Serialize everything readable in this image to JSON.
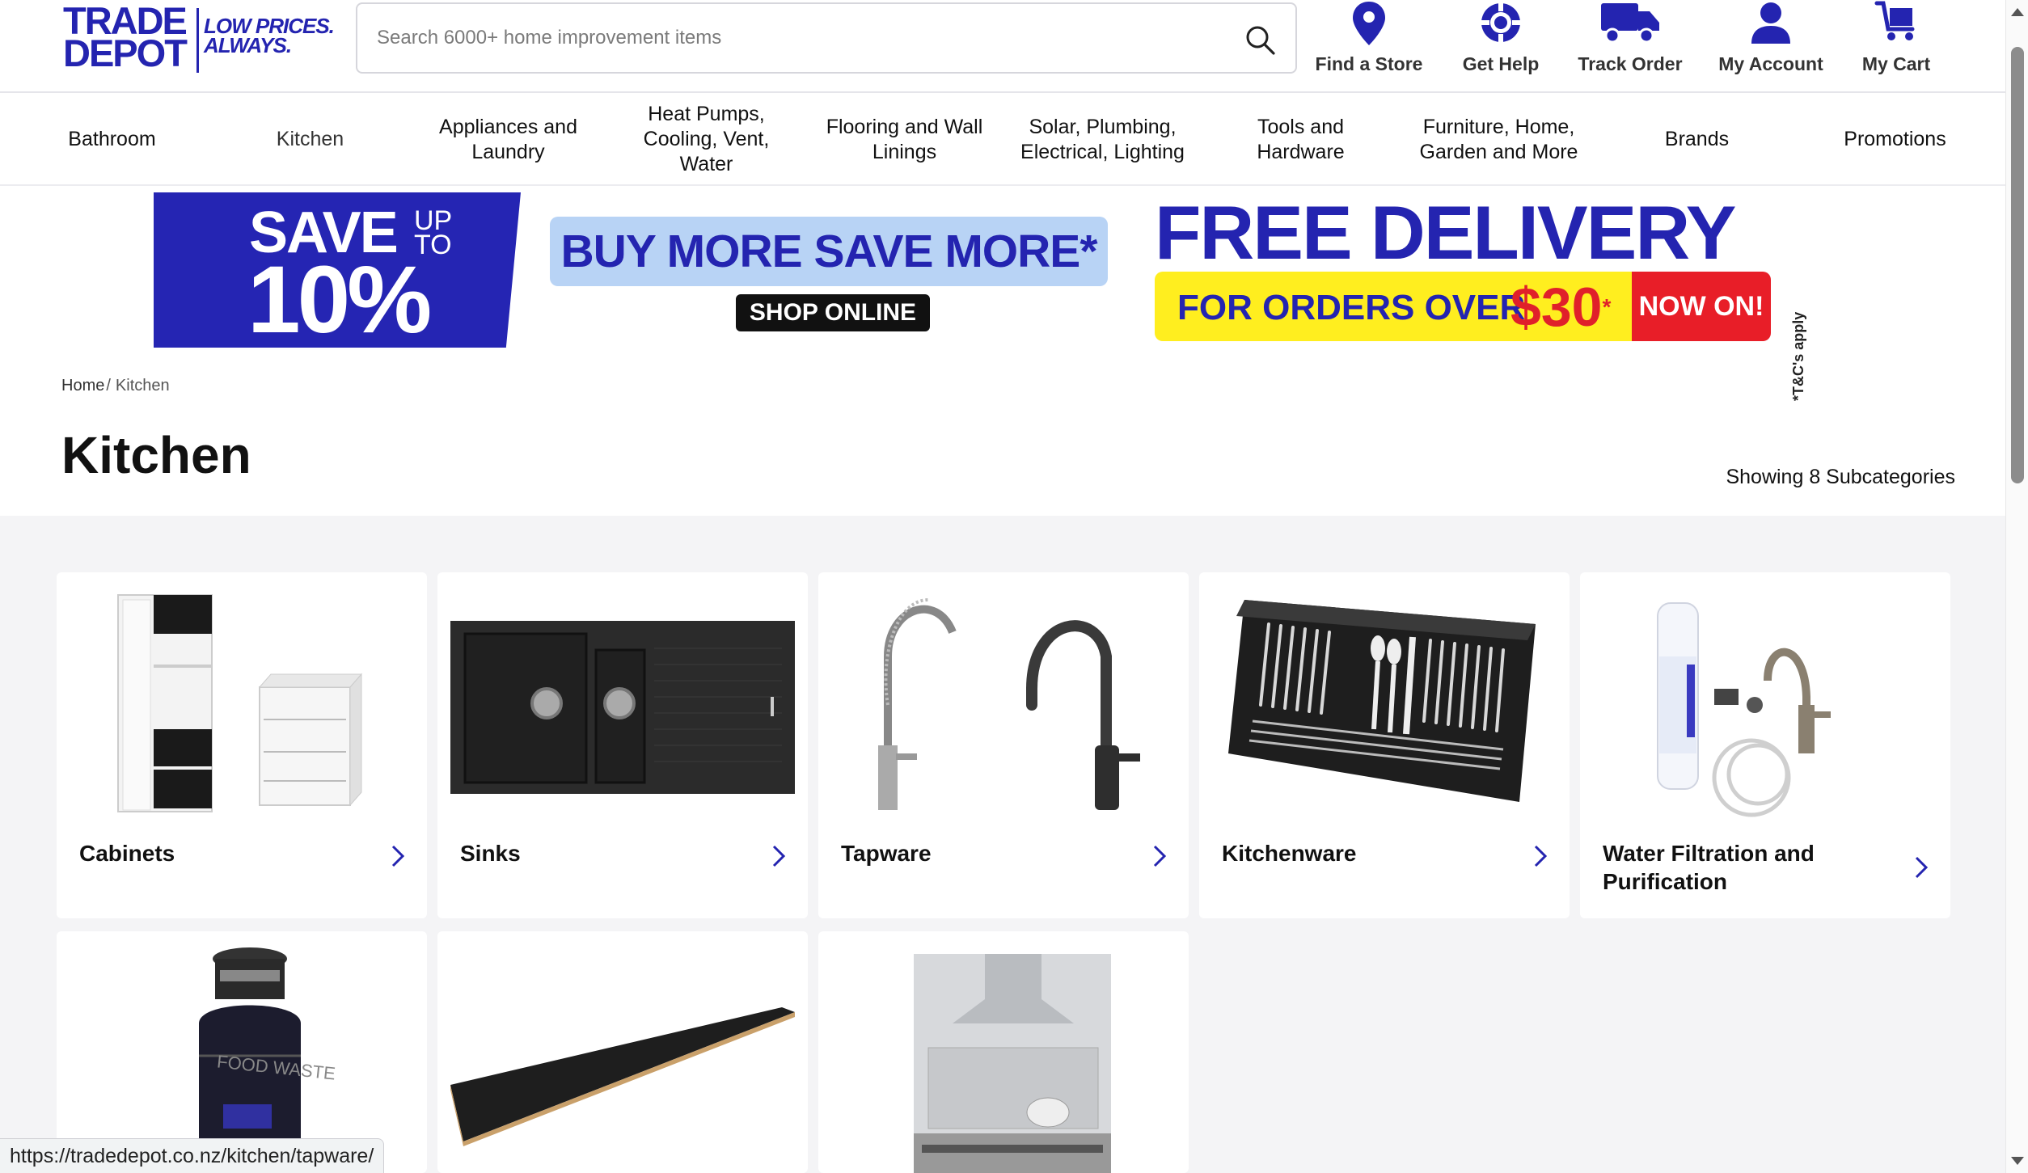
{
  "brand": {
    "logo_line1": "TRADE",
    "logo_line2": "DEPOT",
    "tagline1": "LOW PRICES.",
    "tagline2": "ALWAYS.",
    "color": "#2424b0"
  },
  "search": {
    "placeholder": "Search 6000+ home improvement items",
    "value": ""
  },
  "header_nav": [
    {
      "label": "Find a Store",
      "icon": "map-pin-icon"
    },
    {
      "label": "Get Help",
      "icon": "lifebuoy-icon"
    },
    {
      "label": "Track Order",
      "icon": "truck-icon"
    },
    {
      "label": "My Account",
      "icon": "user-icon"
    },
    {
      "label": "My Cart",
      "icon": "cart-icon"
    }
  ],
  "categories": [
    "Bathroom",
    "Kitchen",
    "Appliances and Laundry",
    "Heat Pumps, Cooling, Vent, Water",
    "Flooring and Wall Linings",
    "Solar, Plumbing, Electrical, Lighting",
    "Tools and Hardware",
    "Furniture, Home, Garden and More",
    "Brands",
    "Promotions"
  ],
  "banner": {
    "save": "SAVE",
    "up_to_1": "UP",
    "up_to_2": "TO",
    "percent": "10%",
    "headline": "BUY MORE SAVE MORE*",
    "cta": "SHOP ONLINE",
    "free_delivery": "FREE DELIVERY",
    "orders_over": "FOR ORDERS OVER",
    "amount": "$30",
    "amount_mark": "*",
    "now_on": "NOW ON!",
    "terms": "*T&C's apply"
  },
  "breadcrumb": {
    "home": "Home",
    "separator": "/",
    "current": "Kitchen"
  },
  "page_title": "Kitchen",
  "subcategory_count_text": "Showing 8 Subcategories",
  "subcategories": [
    {
      "name": "Cabinets",
      "image": "cabinet-image"
    },
    {
      "name": "Sinks",
      "image": "sink-image"
    },
    {
      "name": "Tapware",
      "image": "tap-image"
    },
    {
      "name": "Kitchenware",
      "image": "cutlery-set-image"
    },
    {
      "name": "Water Filtration and Purification",
      "image": "water-filter-image"
    },
    {
      "name": "",
      "image": "food-waste-disposer-image"
    },
    {
      "name": "",
      "image": "benchtop-image"
    },
    {
      "name": "",
      "image": "splashback-image"
    }
  ],
  "status_url": "https://tradedepot.co.nz/kitchen/tapware/",
  "colors": {
    "brand_blue": "#2424b0",
    "banner_blue": "#2525b3",
    "banner_light": "#b8d3f5",
    "yellow": "#ffee1f",
    "red": "#e81e28",
    "grid_bg": "#f4f4f6"
  }
}
